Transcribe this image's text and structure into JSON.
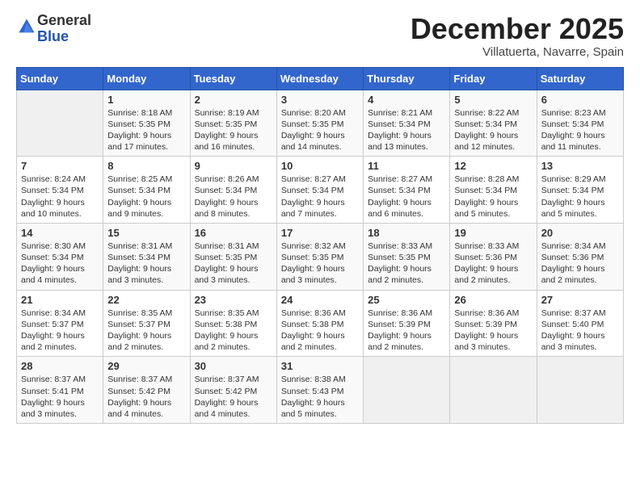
{
  "logo": {
    "general": "General",
    "blue": "Blue"
  },
  "title": "December 2025",
  "location": "Villatuerta, Navarre, Spain",
  "days_of_week": [
    "Sunday",
    "Monday",
    "Tuesday",
    "Wednesday",
    "Thursday",
    "Friday",
    "Saturday"
  ],
  "weeks": [
    [
      {
        "day": "",
        "info": ""
      },
      {
        "day": "1",
        "info": "Sunrise: 8:18 AM\nSunset: 5:35 PM\nDaylight: 9 hours\nand 17 minutes."
      },
      {
        "day": "2",
        "info": "Sunrise: 8:19 AM\nSunset: 5:35 PM\nDaylight: 9 hours\nand 16 minutes."
      },
      {
        "day": "3",
        "info": "Sunrise: 8:20 AM\nSunset: 5:35 PM\nDaylight: 9 hours\nand 14 minutes."
      },
      {
        "day": "4",
        "info": "Sunrise: 8:21 AM\nSunset: 5:34 PM\nDaylight: 9 hours\nand 13 minutes."
      },
      {
        "day": "5",
        "info": "Sunrise: 8:22 AM\nSunset: 5:34 PM\nDaylight: 9 hours\nand 12 minutes."
      },
      {
        "day": "6",
        "info": "Sunrise: 8:23 AM\nSunset: 5:34 PM\nDaylight: 9 hours\nand 11 minutes."
      }
    ],
    [
      {
        "day": "7",
        "info": "Sunrise: 8:24 AM\nSunset: 5:34 PM\nDaylight: 9 hours\nand 10 minutes."
      },
      {
        "day": "8",
        "info": "Sunrise: 8:25 AM\nSunset: 5:34 PM\nDaylight: 9 hours\nand 9 minutes."
      },
      {
        "day": "9",
        "info": "Sunrise: 8:26 AM\nSunset: 5:34 PM\nDaylight: 9 hours\nand 8 minutes."
      },
      {
        "day": "10",
        "info": "Sunrise: 8:27 AM\nSunset: 5:34 PM\nDaylight: 9 hours\nand 7 minutes."
      },
      {
        "day": "11",
        "info": "Sunrise: 8:27 AM\nSunset: 5:34 PM\nDaylight: 9 hours\nand 6 minutes."
      },
      {
        "day": "12",
        "info": "Sunrise: 8:28 AM\nSunset: 5:34 PM\nDaylight: 9 hours\nand 5 minutes."
      },
      {
        "day": "13",
        "info": "Sunrise: 8:29 AM\nSunset: 5:34 PM\nDaylight: 9 hours\nand 5 minutes."
      }
    ],
    [
      {
        "day": "14",
        "info": "Sunrise: 8:30 AM\nSunset: 5:34 PM\nDaylight: 9 hours\nand 4 minutes."
      },
      {
        "day": "15",
        "info": "Sunrise: 8:31 AM\nSunset: 5:34 PM\nDaylight: 9 hours\nand 3 minutes."
      },
      {
        "day": "16",
        "info": "Sunrise: 8:31 AM\nSunset: 5:35 PM\nDaylight: 9 hours\nand 3 minutes."
      },
      {
        "day": "17",
        "info": "Sunrise: 8:32 AM\nSunset: 5:35 PM\nDaylight: 9 hours\nand 3 minutes."
      },
      {
        "day": "18",
        "info": "Sunrise: 8:33 AM\nSunset: 5:35 PM\nDaylight: 9 hours\nand 2 minutes."
      },
      {
        "day": "19",
        "info": "Sunrise: 8:33 AM\nSunset: 5:36 PM\nDaylight: 9 hours\nand 2 minutes."
      },
      {
        "day": "20",
        "info": "Sunrise: 8:34 AM\nSunset: 5:36 PM\nDaylight: 9 hours\nand 2 minutes."
      }
    ],
    [
      {
        "day": "21",
        "info": "Sunrise: 8:34 AM\nSunset: 5:37 PM\nDaylight: 9 hours\nand 2 minutes."
      },
      {
        "day": "22",
        "info": "Sunrise: 8:35 AM\nSunset: 5:37 PM\nDaylight: 9 hours\nand 2 minutes."
      },
      {
        "day": "23",
        "info": "Sunrise: 8:35 AM\nSunset: 5:38 PM\nDaylight: 9 hours\nand 2 minutes."
      },
      {
        "day": "24",
        "info": "Sunrise: 8:36 AM\nSunset: 5:38 PM\nDaylight: 9 hours\nand 2 minutes."
      },
      {
        "day": "25",
        "info": "Sunrise: 8:36 AM\nSunset: 5:39 PM\nDaylight: 9 hours\nand 2 minutes."
      },
      {
        "day": "26",
        "info": "Sunrise: 8:36 AM\nSunset: 5:39 PM\nDaylight: 9 hours\nand 3 minutes."
      },
      {
        "day": "27",
        "info": "Sunrise: 8:37 AM\nSunset: 5:40 PM\nDaylight: 9 hours\nand 3 minutes."
      }
    ],
    [
      {
        "day": "28",
        "info": "Sunrise: 8:37 AM\nSunset: 5:41 PM\nDaylight: 9 hours\nand 3 minutes."
      },
      {
        "day": "29",
        "info": "Sunrise: 8:37 AM\nSunset: 5:42 PM\nDaylight: 9 hours\nand 4 minutes."
      },
      {
        "day": "30",
        "info": "Sunrise: 8:37 AM\nSunset: 5:42 PM\nDaylight: 9 hours\nand 4 minutes."
      },
      {
        "day": "31",
        "info": "Sunrise: 8:38 AM\nSunset: 5:43 PM\nDaylight: 9 hours\nand 5 minutes."
      },
      {
        "day": "",
        "info": ""
      },
      {
        "day": "",
        "info": ""
      },
      {
        "day": "",
        "info": ""
      }
    ]
  ]
}
